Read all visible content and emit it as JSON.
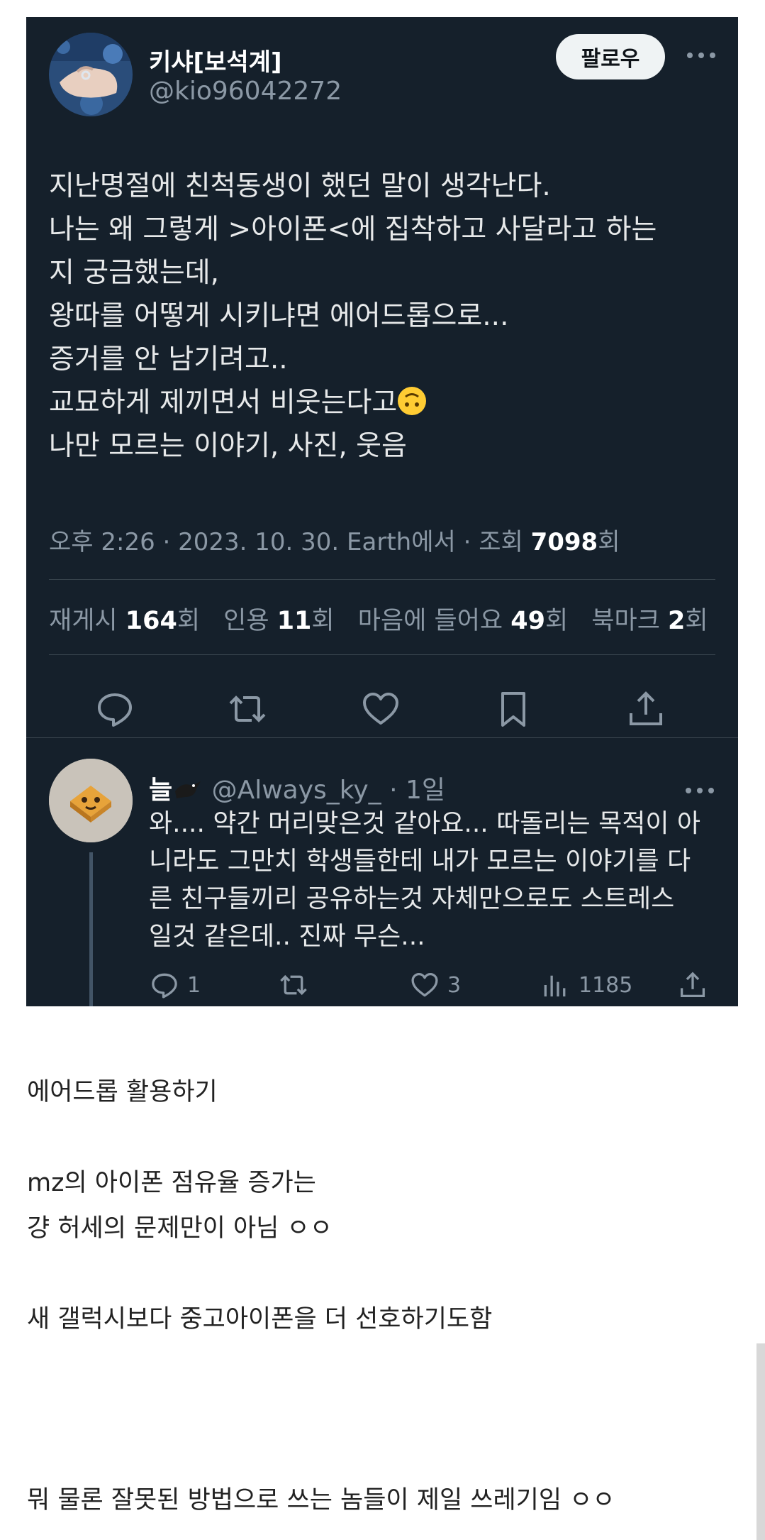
{
  "tweet": {
    "author_name": "키샤[보석계]",
    "author_handle": "@kio96042272",
    "follow_label": "팔로우",
    "lines": [
      "지난명절에 친척동생이 했던 말이 생각난다.",
      "나는 왜 그렇게 >아이폰<에 집착하고 사달라고 하는",
      "지 궁금했는데,",
      "왕따를 어떻게 시키냐면 에어드롭으로...",
      "증거를 안 남기려고..",
      "교묘하게 제끼면서 비웃는다고",
      "나만 모르는 이야기, 사진, 웃음"
    ],
    "emoji": "🙃",
    "meta_prefix": "오후 2:26 · 2023. 10. 30. Earth에서 · 조회 ",
    "views": "7098",
    "views_suffix": "회",
    "stats": {
      "retweets_label": "재게시",
      "retweets": "164",
      "retweets_suffix": "회",
      "quotes_label": "인용",
      "quotes": "11",
      "quotes_suffix": "회",
      "likes_label": "마음에 들어요",
      "likes": "49",
      "likes_suffix": "회",
      "bookmarks_label": "북마크",
      "bookmarks": "2",
      "bookmarks_suffix": "회"
    }
  },
  "reply": {
    "author_name": "늘",
    "author_handle": "@Always_ky_",
    "time": "· 1일",
    "lines": [
      "와.... 약간 머리맞은것 같아요... 따돌리는 목적이 아",
      "니라도 그만치 학생들한테 내가 모르는 이야기를 다",
      "른 친구들끼리 공유하는것 자체만으로도 스트레스",
      "일것 같은데.. 진짜 무슨..."
    ],
    "reply_count": "1",
    "like_count": "3",
    "view_count": "1185"
  },
  "body": {
    "lines": [
      "에어드롭 활용하기",
      "mz의 아이폰 점유율 증가는",
      "걍 허세의 문제만이 아님 ㅇㅇ",
      "새 갤럭시보다 중고아이폰을 더 선호하기도함",
      "뭐 물론 잘못된 방법으로 쓰는 놈들이 제일 쓰레기임 ㅇㅇ"
    ]
  },
  "colors": {
    "card_bg": "#15202b",
    "secondary_text": "#8b98a5",
    "divider": "#38444d"
  }
}
